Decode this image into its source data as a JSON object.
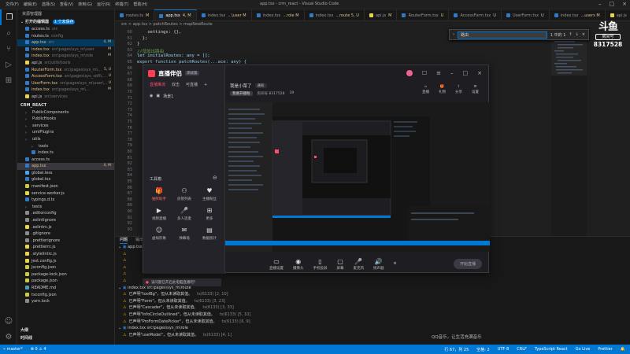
{
  "window": {
    "title": "app.tsx - crm_react - Visual Studio Code",
    "menu": [
      "文件(F)",
      "编辑(E)",
      "选择(S)",
      "查看(V)",
      "转到(G)",
      "运行(R)",
      "终端(T)",
      "帮助(H)"
    ]
  },
  "sidebar": {
    "header": "资源管理器",
    "open_editors_title": "打开的编辑器",
    "open_editors_badge": "1 个未保存",
    "open_editors": [
      {
        "label": "access.ts",
        "path": "src",
        "badge": ""
      },
      {
        "label": "routes.ts",
        "path": "config",
        "badge": ""
      },
      {
        "label": "app.tsx",
        "path": "src",
        "badge": "4, M"
      },
      {
        "label": "index.tsx",
        "path": "src\\pages\\sys_m\\user",
        "badge": "M"
      },
      {
        "label": "index.tsx",
        "path": "src\\pages\\sys_m\\role",
        "badge": "M"
      },
      {
        "label": "api.js",
        "path": "src\\utils\\tools",
        "badge": ""
      },
      {
        "label": "RouterForm.tsx",
        "path": "src\\pages\\sys_m\\...",
        "badge": "5, U"
      },
      {
        "label": "AccessForm.tsx",
        "path": "src\\pages\\sys_soft\\...",
        "badge": "U"
      },
      {
        "label": "UserForm.tsx",
        "path": "src\\pages\\sys_m\\user\\...",
        "badge": "U"
      },
      {
        "label": "index.tsx",
        "path": "src\\pages\\sys_m\\...",
        "badge": "M"
      },
      {
        "label": "api.js",
        "path": "src\\services",
        "badge": ""
      }
    ],
    "project_title": "CRM_REACT",
    "tree": [
      {
        "label": "PublicComponents",
        "type": "folder"
      },
      {
        "label": "PublicHooks",
        "type": "folder"
      },
      {
        "label": "services",
        "type": "folder"
      },
      {
        "label": "umiPlugins",
        "type": "folder"
      },
      {
        "label": "utils",
        "type": "folder"
      },
      {
        "label": "tools",
        "type": "folder"
      },
      {
        "label": "index.ts",
        "type": "ts"
      },
      {
        "label": "access.ts",
        "type": "ts"
      },
      {
        "label": "app.tsx",
        "type": "tsx",
        "badge": "4, M"
      },
      {
        "label": "global.less",
        "type": "css"
      },
      {
        "label": "global.tsx",
        "type": "tsx"
      },
      {
        "label": "manifest.json",
        "type": "json"
      },
      {
        "label": "service-worker.js",
        "type": "js"
      },
      {
        "label": "typings.d.ts",
        "type": "ts"
      },
      {
        "label": "tests",
        "type": "folder"
      },
      {
        "label": ".editorconfig",
        "type": "cfg"
      },
      {
        "label": ".eslintignore",
        "type": "cfg"
      },
      {
        "label": ".eslintrc.js",
        "type": "js"
      },
      {
        "label": ".gitignore",
        "type": "cfg"
      },
      {
        "label": ".prettierignore",
        "type": "cfg"
      },
      {
        "label": ".prettierrc.js",
        "type": "js"
      },
      {
        "label": ".stylelintrc.js",
        "type": "js"
      },
      {
        "label": "jest.config.js",
        "type": "js"
      },
      {
        "label": "jsconfig.json",
        "type": "json"
      },
      {
        "label": "package-lock.json",
        "type": "json"
      },
      {
        "label": "package.json",
        "type": "json"
      },
      {
        "label": "README.md",
        "type": "md"
      },
      {
        "label": "tsconfig.json",
        "type": "json"
      },
      {
        "label": "yarn.lock",
        "type": "lock"
      }
    ],
    "outline": "大纲",
    "timeline": "时间线"
  },
  "tabs": [
    {
      "label": "routes.ts",
      "mod": "M"
    },
    {
      "label": "app.tsx",
      "mod": "4, M"
    },
    {
      "label": "index.tsx",
      "mod": "...\\user M"
    },
    {
      "label": "index.tsx",
      "mod": "...role M"
    },
    {
      "label": "index.tsx",
      "mod": "...route 5, U"
    },
    {
      "label": "api.js",
      "mod": "M"
    },
    {
      "label": "RouterForm.tsx",
      "mod": "U"
    },
    {
      "label": "AccessForm.tsx",
      "mod": "U"
    },
    {
      "label": "UserForm.tsx",
      "mod": "U"
    },
    {
      "label": "index.tsx",
      "mod": "...users M"
    },
    {
      "label": "api.js",
      "mod": ""
    }
  ],
  "breadcrumb": "src > app.tsx > patchRoutes > mapNewRoute",
  "editor": {
    "lines": [
      {
        "n": "60",
        "text": "    settings: {},"
      },
      {
        "n": "61",
        "text": "  };"
      },
      {
        "n": "62",
        "text": "}"
      },
      {
        "n": "63",
        "text": "//增加出路由"
      },
      {
        "n": "64",
        "text": "let initialRoutes: any = [];"
      },
      {
        "n": "65",
        "text": "export function patchRoutes(...ace: any) {"
      },
      {
        "n": "66",
        "text": ""
      },
      {
        "n": "67",
        "text": ""
      },
      {
        "n": "68",
        "text": ""
      },
      {
        "n": "69",
        "text": ""
      },
      {
        "n": "70",
        "text": ""
      },
      {
        "n": "71",
        "text": ""
      },
      {
        "n": "72",
        "text": ""
      },
      {
        "n": "73",
        "text": ""
      },
      {
        "n": "74",
        "text": ""
      },
      {
        "n": "75",
        "text": ""
      },
      {
        "n": "76",
        "text": ""
      },
      {
        "n": "77",
        "text": ""
      },
      {
        "n": "78",
        "text": ""
      },
      {
        "n": "79",
        "text": ""
      },
      {
        "n": "80",
        "text": ""
      },
      {
        "n": "81",
        "text": ""
      },
      {
        "n": "82",
        "text": ""
      },
      {
        "n": "83",
        "text": ""
      },
      {
        "n": "84",
        "text": ""
      },
      {
        "n": "85",
        "text": ""
      },
      {
        "n": "86",
        "text": ""
      },
      {
        "n": "87",
        "text": ""
      },
      {
        "n": "88",
        "text": ""
      },
      {
        "n": "89",
        "text": ""
      },
      {
        "n": "90",
        "text": ""
      },
      {
        "n": "91",
        "text": ""
      },
      {
        "n": "92",
        "text": ""
      },
      {
        "n": "93",
        "text": ""
      }
    ],
    "find": {
      "value": "路由",
      "result": "1 中的 1"
    }
  },
  "panel": {
    "tabs": [
      "问题",
      "输出",
      "调试控制台",
      "终端"
    ],
    "active_tab": "问题",
    "rows": [
      {
        "icon": "folder",
        "text": "app.tsx  src",
        "loc": ""
      },
      {
        "icon": "warn",
        "text": "",
        "loc": ""
      },
      {
        "icon": "warn",
        "text": "",
        "loc": ""
      },
      {
        "icon": "warn",
        "text": "",
        "loc": ""
      },
      {
        "icon": "warn",
        "text": "",
        "loc": ""
      },
      {
        "icon": "warn",
        "text": "",
        "loc": ""
      },
      {
        "icon": "folder",
        "text": "index.tsx  src\\pages\\sys_m\\route",
        "loc": ""
      },
      {
        "icon": "warn",
        "text": "已声明\"toolBg\"，但从未读取其值。",
        "loc": "ts(6133) [2, 10]"
      },
      {
        "icon": "warn",
        "text": "已声明\"Form\"，但从未读取其值。",
        "loc": "ts(6133) [3, 23]"
      },
      {
        "icon": "warn",
        "text": "已声明\"Cascader\"，但从未读取其值。",
        "loc": "ts(6133) [3, 33]"
      },
      {
        "icon": "warn",
        "text": "已声明\"InfoCircleOutlined\"，但从未读取其值。",
        "loc": "ts(6133) [5, 10]"
      },
      {
        "icon": "warn",
        "text": "已声明\"ProFormDatePicker\"，但从未读取其值。",
        "loc": "ts(6133) [6, 9]"
      },
      {
        "icon": "folder",
        "text": "index.tsx  src\\pages\\sys_m\\role",
        "loc": ""
      },
      {
        "icon": "warn",
        "text": "已声明\"useModel\"，但从未读取其值。",
        "loc": "ts(6133) [4, 1]"
      }
    ]
  },
  "statusbar": {
    "branch": "master*",
    "errors": "0",
    "warnings": "4",
    "position": "行 67，列 25",
    "spaces": "空格: 2",
    "encoding": "UTF-8",
    "eol": "CRLF",
    "lang": "TypeScript React",
    "golive": "Go Live",
    "prettier": "Prettier"
  },
  "watermark": {
    "logo": "斗鱼",
    "sub": "房间号",
    "room": "8317528"
  },
  "qq_text": "QQ音乐，让生活充满音乐",
  "live": {
    "brand": "直播伴侣",
    "version": "测试版",
    "left_tabs": [
      "直播推流",
      "双击",
      "可直播"
    ],
    "scene_label": "场景1",
    "tools_title": "工具箱",
    "tools": [
      {
        "label": "抽奖助手",
        "icon": "gift-icon",
        "hot": true
      },
      {
        "label": "房管列表",
        "icon": "users-icon",
        "hot": false
      },
      {
        "label": "主播粉丝",
        "icon": "heart-icon",
        "hot": false
      },
      {
        "label": "视频直播",
        "icon": "video-icon",
        "hot": false
      },
      {
        "label": "多人连麦",
        "icon": "mic-icon",
        "hot": false
      },
      {
        "label": "更多",
        "icon": "grid-icon",
        "hot": false
      },
      {
        "label": "虚拟形象",
        "icon": "avatar-icon",
        "hot": false
      },
      {
        "label": "弹幕墙",
        "icon": "chat-icon",
        "hot": false
      },
      {
        "label": "数据统计",
        "icon": "chart-icon",
        "hot": false
      }
    ],
    "stream_title": "我是小菜了",
    "stream_tag": "通知",
    "stream_sub_tag": "我要开播啦",
    "stream_room": "房间号 8317528",
    "stream_count": "39",
    "top_icons": [
      "头像",
      "设置",
      "最小化",
      "最大化",
      "关闭"
    ],
    "stream_icons": [
      {
        "label": "直播",
        "icon": "home-icon"
      },
      {
        "label": "礼物",
        "icon": "gift-icon"
      },
      {
        "label": "分享",
        "icon": "share-icon"
      },
      {
        "label": "设置",
        "icon": "gear-icon"
      }
    ],
    "bottom_controls": [
      {
        "label": "直播设置",
        "icon": "monitor-icon"
      },
      {
        "label": "摄像头",
        "icon": "camera-icon"
      },
      {
        "label": "手机投屏",
        "icon": "phone-icon"
      },
      {
        "label": "屏幕",
        "icon": "screen-icon"
      },
      {
        "label": "麦克风",
        "icon": "mic-icon",
        "active": true
      },
      {
        "label": "扬声器",
        "icon": "speaker-icon"
      }
    ],
    "start_button": "开始直播",
    "banner": "该问题已开启此电脑直播吧？"
  }
}
